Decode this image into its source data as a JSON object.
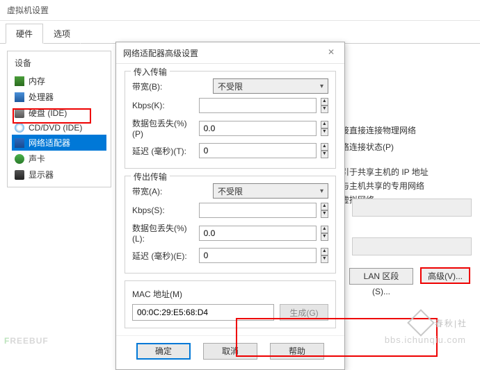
{
  "window": {
    "title": "虚拟机设置"
  },
  "tabs": {
    "hardware": "硬件",
    "options": "选项"
  },
  "devices": {
    "header": "设备",
    "items": [
      {
        "label": "内存",
        "icon": "icon-mem"
      },
      {
        "label": "处理器",
        "icon": "icon-cpu"
      },
      {
        "label": "硬盘 (IDE)",
        "icon": "icon-hdd"
      },
      {
        "label": "CD/DVD (IDE)",
        "icon": "icon-cd"
      },
      {
        "label": "网络适配器",
        "icon": "icon-net",
        "selected": true
      },
      {
        "label": "声卡",
        "icon": "icon-snd"
      },
      {
        "label": "显示器",
        "icon": "icon-dsp"
      }
    ]
  },
  "right": {
    "line1": "接直接连接物理网络",
    "line2": "络连接状态(P)",
    "line3": "引于共享主机的 IP 地址",
    "line4": "与主机共享的专用网络",
    "line5": "虚拟网络",
    "lanseg": "LAN 区段(S)...",
    "advanced": "高级(V)..."
  },
  "dialog": {
    "title": "网络适配器高级设置",
    "incoming": {
      "group": "传入传输",
      "bandwidth_label": "带宽(B):",
      "bandwidth_value": "不受限",
      "kbps_label": "Kbps(K):",
      "kbps_value": "",
      "loss_label": "数据包丢失(%)(P)",
      "loss_value": "0.0",
      "latency_label": "延迟 (毫秒)(T):",
      "latency_value": "0"
    },
    "outgoing": {
      "group": "传出传输",
      "bandwidth_label": "带宽(A):",
      "bandwidth_value": "不受限",
      "kbps_label": "Kbps(S):",
      "kbps_value": "",
      "loss_label": "数据包丢失(%)(L):",
      "loss_value": "0.0",
      "latency_label": "延迟 (毫秒)(E):",
      "latency_value": "0"
    },
    "mac": {
      "group": "MAC 地址(M)",
      "value": "00:0C:29:E5:68:D4",
      "generate": "生成(G)"
    },
    "buttons": {
      "ok": "确定",
      "cancel": "取消",
      "help": "帮助"
    }
  },
  "watermarks": {
    "w1": "春秋|社",
    "w2": "bbs.ichunqiu.com",
    "w3a": "REE",
    "w3b": "BUF"
  }
}
